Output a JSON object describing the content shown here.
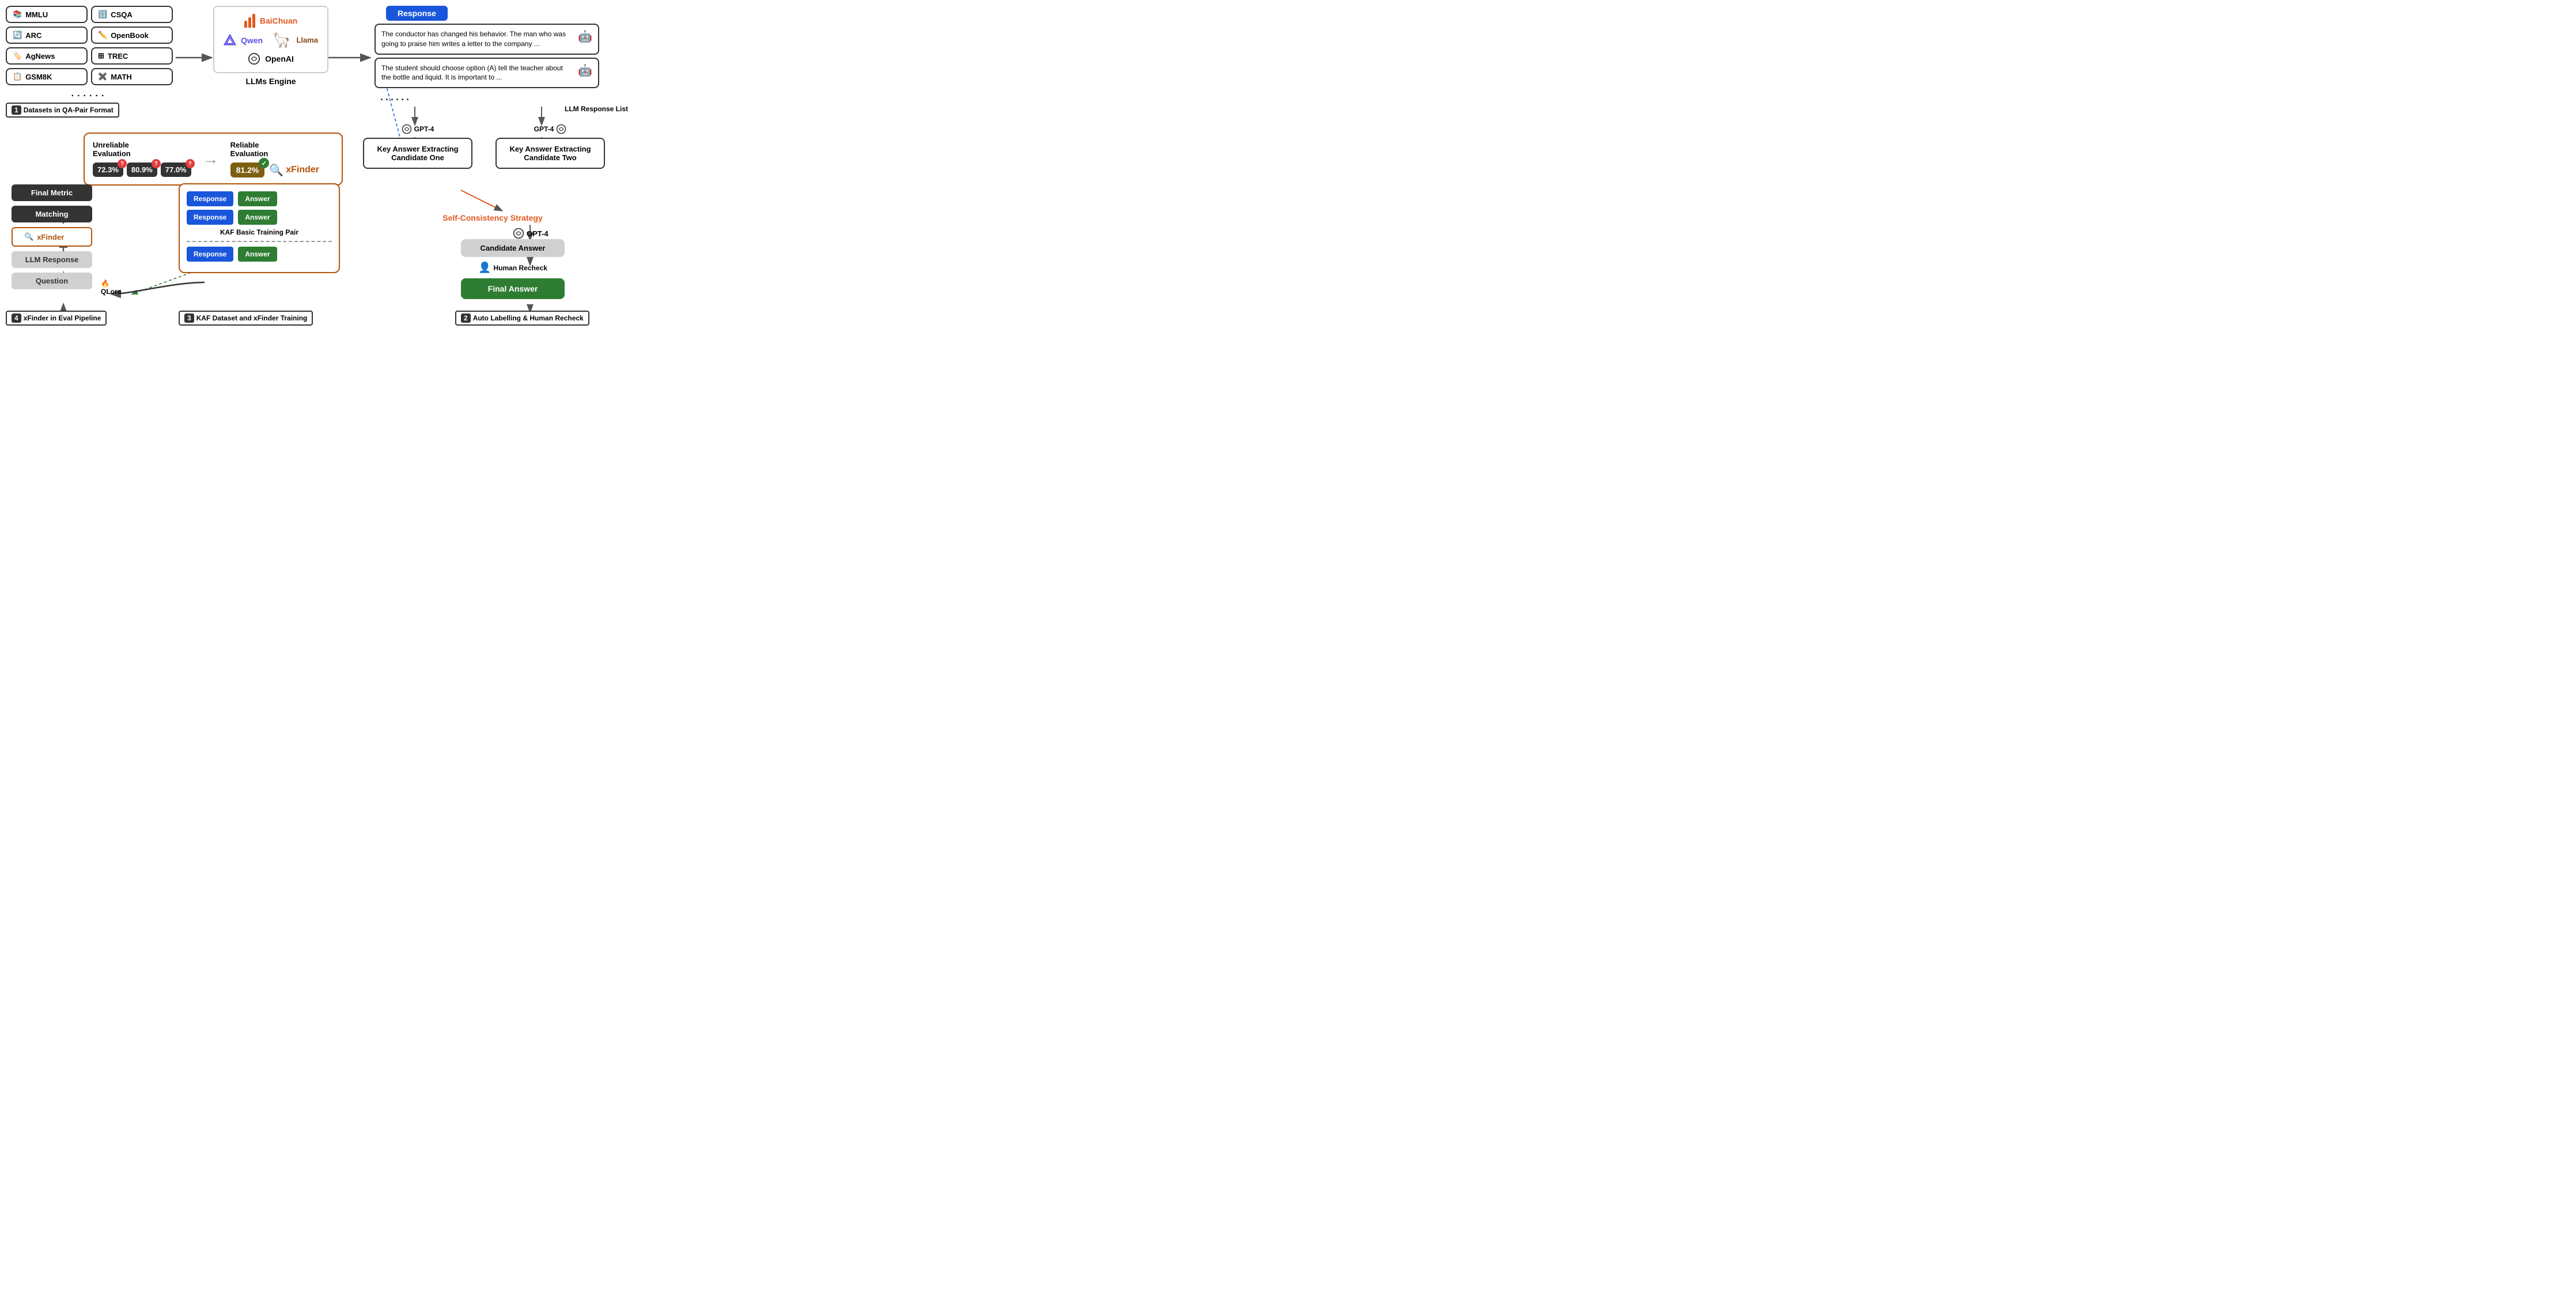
{
  "datasets": {
    "items": [
      {
        "label": "MMLU",
        "icon": "📚"
      },
      {
        "label": "CSQA",
        "icon": "🔢"
      },
      {
        "label": "ARC",
        "icon": "🔄"
      },
      {
        "label": "OpenBook",
        "icon": "✏️"
      },
      {
        "label": "AgNews",
        "icon": "🏷️"
      },
      {
        "label": "TREC",
        "icon": "⊞"
      },
      {
        "label": "GSM8K",
        "icon": "📋"
      },
      {
        "label": "MATH",
        "icon": "✖️"
      }
    ],
    "dots": "......",
    "section_label": "Datasets in QA-Pair Format",
    "section_num": "1"
  },
  "llms_engine": {
    "title": "LLMs Engine",
    "models": [
      "BaiChuan",
      "Qwen",
      "Llama",
      "OpenAI"
    ]
  },
  "response_section": {
    "button_label": "Response",
    "response1": "The conductor has changed his behavior. The man who was going to praise him writes a letter to the company ...",
    "response2": "The student should choose option (A) tell the teacher about the bottle and liquid. It is important to ...",
    "dots": "......",
    "list_label": "LLM Response List"
  },
  "key_answer": {
    "candidate_one": {
      "gpt4": "GPT-4",
      "title": "Key Answer Extracting\nCandidate One"
    },
    "candidate_two": {
      "gpt4": "GPT-4",
      "title": "Key Answer Extracting\nCandidate Two"
    }
  },
  "self_consistency": {
    "label": "Self-Consistency Strategy",
    "gpt4": "GPT-4"
  },
  "right_flow": {
    "candidate_answer": "Candidate Answer",
    "human_recheck": "Human Recheck",
    "final_answer": "Final Answer",
    "section_label": "Auto Labelling & Human Recheck",
    "section_num": "2"
  },
  "eval_box": {
    "unreliable_label": "Unreliable\nEvaluation",
    "reliable_label": "Reliable\nEvaluation",
    "pct1": "72.3%",
    "pct2": "80.9%",
    "pct3": "77.0%",
    "reliable_pct": "81.2%",
    "xfinder": "xFinder"
  },
  "pipeline": {
    "final_metric": "Final Metric",
    "matching": "Matching",
    "xfinder": "xFinder",
    "llm_response": "LLM Response",
    "question": "Question",
    "qlora": "QLora",
    "section_label": "xFinder in Eval Pipeline",
    "section_num": "4"
  },
  "kaf": {
    "response": "Response",
    "answer": "Answer",
    "title": "KAF Basic Training Pair",
    "section_label": "KAF Dataset and xFinder Training",
    "section_num": "3"
  }
}
